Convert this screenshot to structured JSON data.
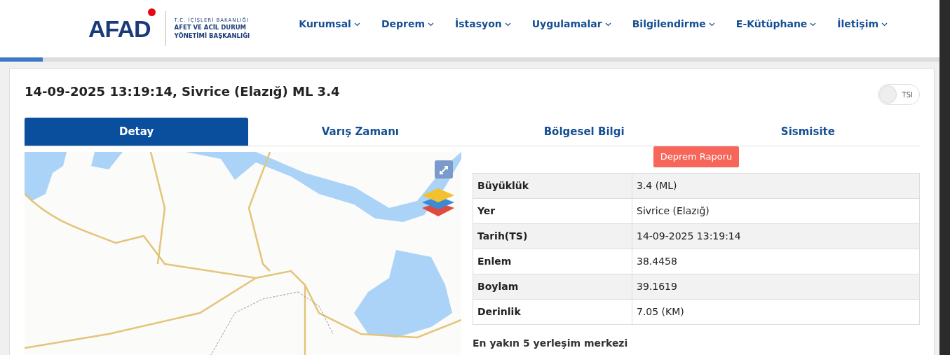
{
  "header": {
    "logo": {
      "wordmark": "AFAD",
      "line_1": "T.C. İÇİŞLERİ BAKANLIĞI",
      "line_2": "AFET VE ACİL DURUM",
      "line_3": "YÖNETİMİ BAŞKANLIĞI"
    },
    "nav": [
      {
        "label": "Kurumsal"
      },
      {
        "label": "Deprem"
      },
      {
        "label": "İstasyon"
      },
      {
        "label": "Uygulamalar"
      },
      {
        "label": "Bilgilendirme"
      },
      {
        "label": "E-Kütüphane"
      },
      {
        "label": "İletişim"
      }
    ]
  },
  "loading_bar": {
    "level": 0.045
  },
  "event": {
    "title": "14-09-2025 13:19:14, Sivrice (Elazığ) ML 3.4",
    "tsi_toggle": {
      "label": "TSI",
      "on": false
    }
  },
  "tabs": [
    {
      "label": "Detay",
      "selected": true
    },
    {
      "label": "Varış Zamanı",
      "selected": false
    },
    {
      "label": "Bölgesel Bilgi",
      "selected": false
    },
    {
      "label": "Sismisite",
      "selected": false
    }
  ],
  "report_button": "Deprem Raporu",
  "details": [
    {
      "label": "Büyüklük",
      "value": "3.4 (ML)"
    },
    {
      "label": "Yer",
      "value": "Sivrice (Elazığ)"
    },
    {
      "label": "Tarih(TS)",
      "value": "14-09-2025 13:19:14"
    },
    {
      "label": "Enlem",
      "value": "38.4458"
    },
    {
      "label": "Boylam",
      "value": "39.1619"
    },
    {
      "label": "Derinlik",
      "value": "7.05 (KM)"
    }
  ],
  "nearest_heading": "En yakın 5 yerleşim merkezi"
}
